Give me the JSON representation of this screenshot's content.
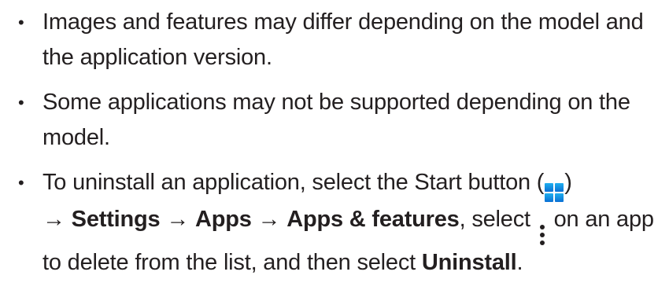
{
  "notes": [
    {
      "bullet": "•",
      "text": "Images and features may differ depending on the model and the application version."
    },
    {
      "bullet": "•",
      "text": "Some applications may not be supported depending on the model."
    },
    {
      "bullet": "•",
      "part1": "To uninstall an application, select the Start button (",
      "part2": ")",
      "arrow1": " → ",
      "settings": "Settings",
      "arrow2": " → ",
      "apps": "Apps",
      "arrow3": " → ",
      "apps_features": "Apps & features",
      "part3": ", select ",
      "part4": " on an app to delete from the list, and then select ",
      "uninstall": "Uninstall",
      "part5": "."
    }
  ],
  "icons": {
    "start_button": "windows-start-icon",
    "more_options": "vertical-ellipsis-icon"
  },
  "colors": {
    "text": "#231f20",
    "start_icon": "#1a9fe8"
  }
}
